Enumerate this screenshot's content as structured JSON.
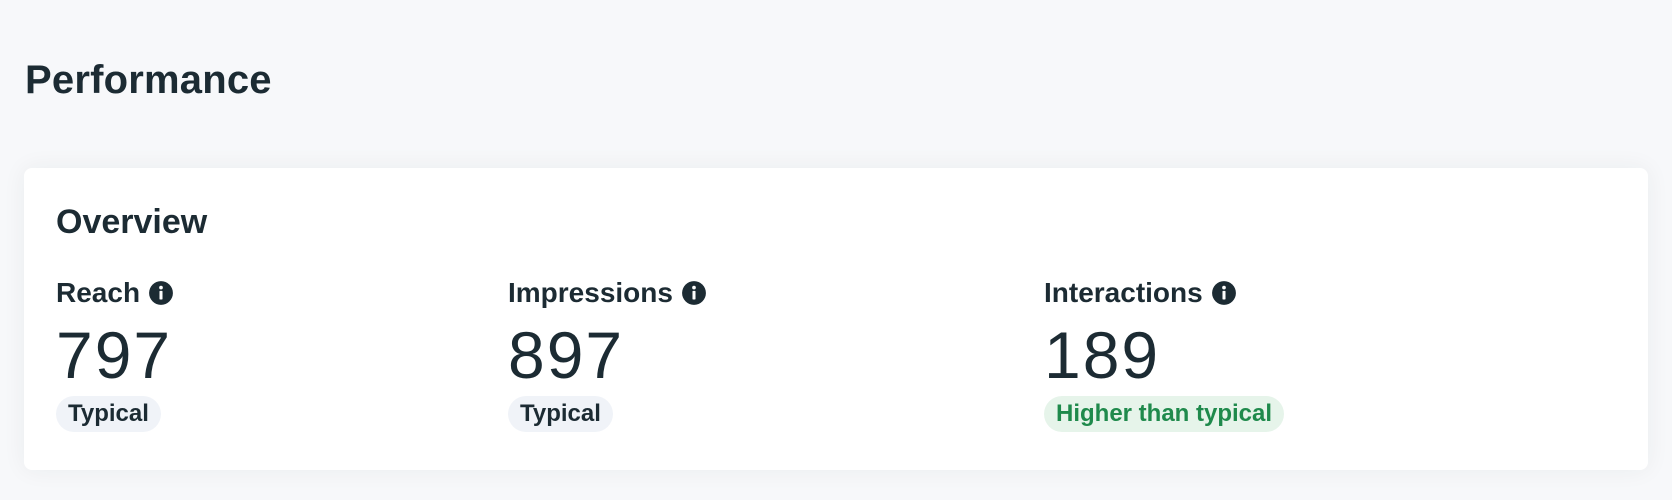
{
  "page": {
    "title": "Performance"
  },
  "overview": {
    "title": "Overview",
    "metrics": [
      {
        "label": "Reach",
        "value": "797",
        "badge": "Typical",
        "badge_status": "neutral",
        "info_icon": "info-icon"
      },
      {
        "label": "Impressions",
        "value": "897",
        "badge": "Typical",
        "badge_status": "neutral",
        "info_icon": "info-icon"
      },
      {
        "label": "Interactions",
        "value": "189",
        "badge": "Higher than typical",
        "badge_status": "positive",
        "info_icon": "info-icon"
      }
    ]
  },
  "colors": {
    "text": "#1c2b33",
    "neutral_badge_bg": "#f0f3f8",
    "positive_badge_bg": "#e6f4ea",
    "positive_badge_text": "#1f8a4c",
    "page_bg": "#f7f8fa",
    "card_bg": "#ffffff"
  }
}
